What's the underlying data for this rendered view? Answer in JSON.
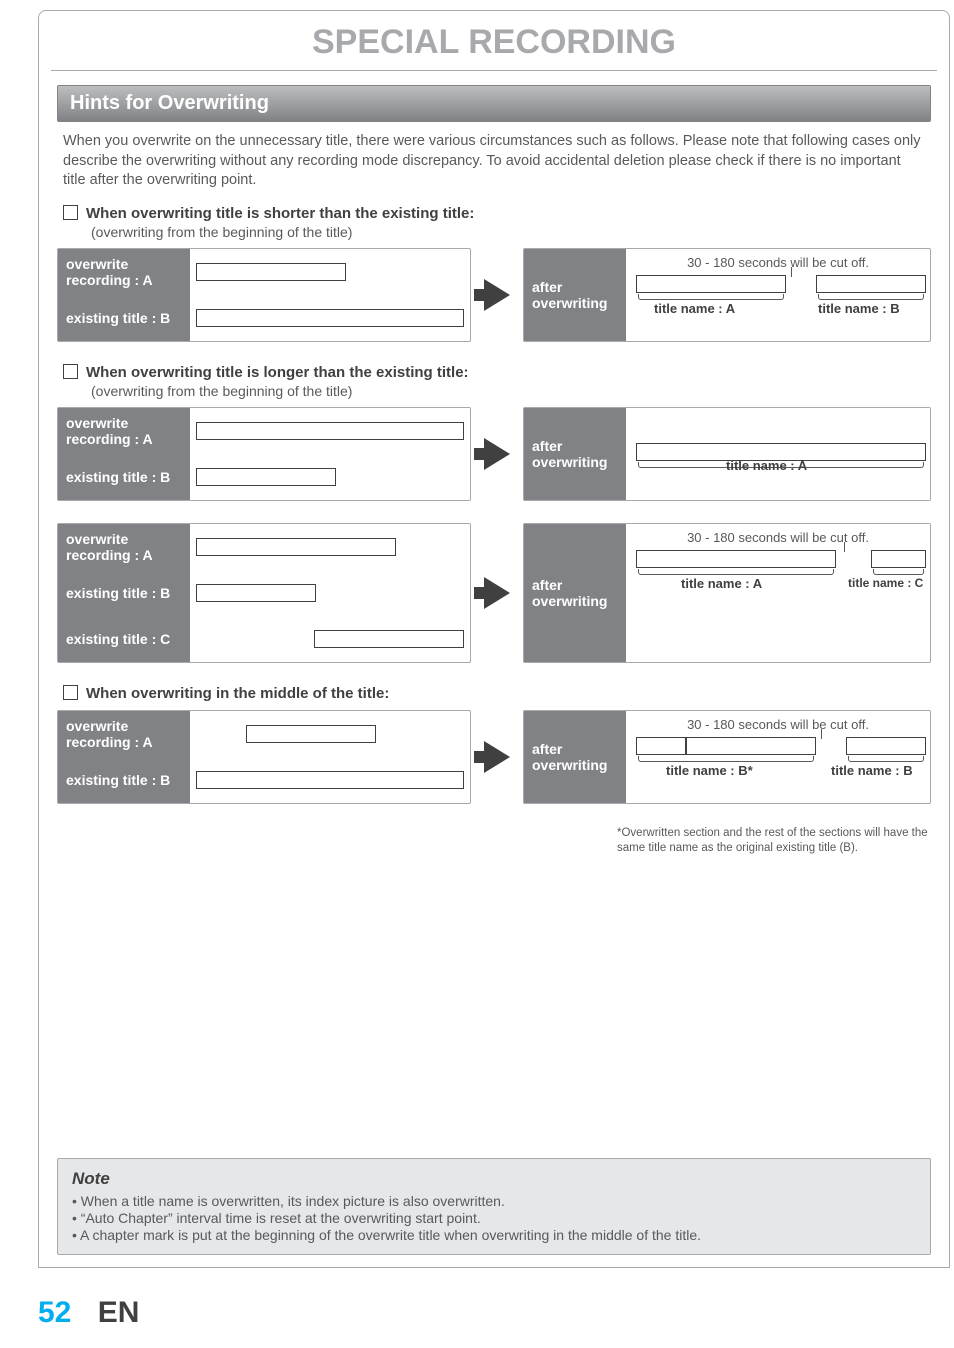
{
  "header": {
    "title": "SPECIAL RECORDING"
  },
  "section": {
    "heading": "Hints for Overwriting"
  },
  "intro": "When you overwrite on the unnecessary title, there were various circumstances such as follows.  Please note that following cases only describe the overwriting without any recording mode discrepancy.  To avoid accidental deletion please check if there is no important title after the overwriting point.",
  "labels": {
    "overwrite_recording_a": "overwrite recording : A",
    "existing_title_b": "existing title : B",
    "existing_title_c": "existing title : C",
    "after_overwriting": "after overwriting",
    "cutoff": "30 - 180 seconds will be cut off.",
    "title_name_a": "title name : A",
    "title_name_b": "title name : B",
    "title_name_b_star": "title name : B*",
    "title_name_c": "title name : C"
  },
  "cases": {
    "shorter": {
      "title": "When overwriting title is shorter than the existing title:",
      "sub": "(overwriting from the beginning of the title)"
    },
    "longer": {
      "title": "When overwriting title is longer than the existing title:",
      "sub": "(overwriting from the beginning of the title)"
    },
    "middle": {
      "title": "When overwriting in the middle of the title:"
    }
  },
  "footnote": "*Overwritten section and the rest of the sections will have the same title name as the original existing title (B).",
  "note": {
    "heading": "Note",
    "items": [
      "When a title name is overwritten, its index picture is also overwritten.",
      "“Auto Chapter” interval time is reset at the overwriting start point.",
      "A chapter mark is put at the beginning of the overwrite title when overwriting in the middle of the title."
    ]
  },
  "footer": {
    "page": "52",
    "lang": "EN"
  }
}
